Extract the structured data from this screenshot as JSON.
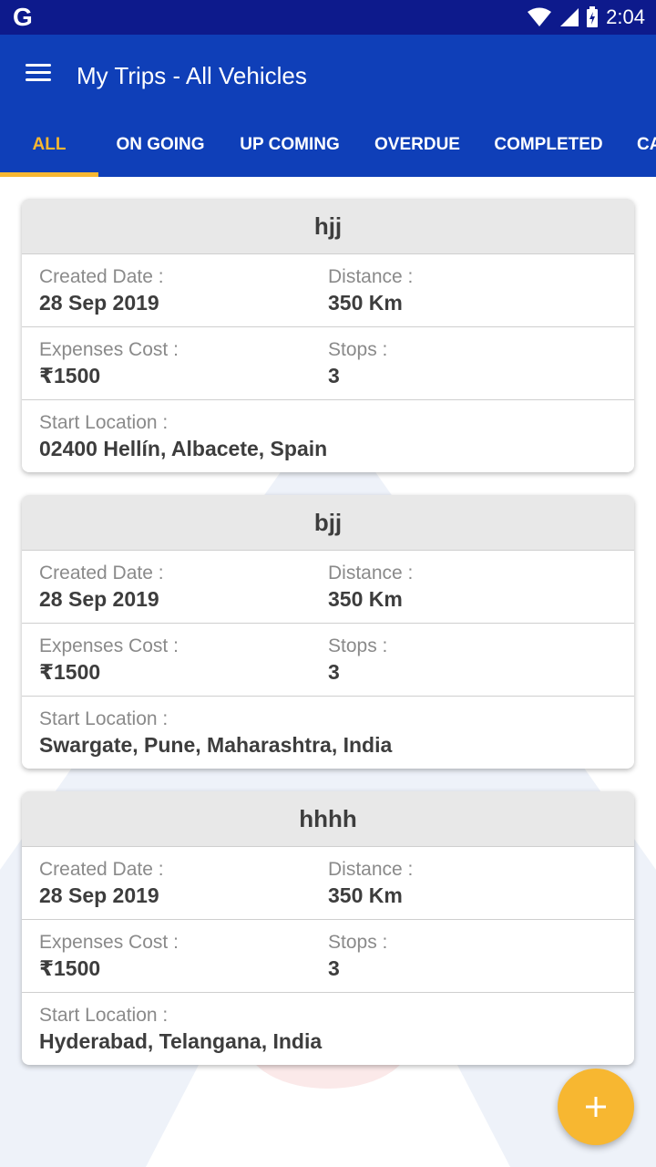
{
  "status_bar": {
    "carrier_icon": "G",
    "time": "2:04"
  },
  "app_bar": {
    "title": "My Trips - All Vehicles"
  },
  "tabs": [
    {
      "label": "ALL",
      "active": true
    },
    {
      "label": "ON GOING",
      "active": false
    },
    {
      "label": "UP COMING",
      "active": false
    },
    {
      "label": "OVERDUE",
      "active": false
    },
    {
      "label": "COMPLETED",
      "active": false
    },
    {
      "label": "CA",
      "active": false
    }
  ],
  "labels": {
    "created_date": "Created Date :",
    "distance": "Distance :",
    "expenses_cost": "Expenses Cost :",
    "stops": "Stops :",
    "start_location": "Start Location :"
  },
  "trips": [
    {
      "name": "hjj",
      "created_date": "28 Sep 2019",
      "distance": "350 Km",
      "expenses_cost": "₹1500",
      "stops": "3",
      "start_location": "02400 Hellín, Albacete, Spain"
    },
    {
      "name": "bjj",
      "created_date": "28 Sep 2019",
      "distance": "350 Km",
      "expenses_cost": "₹1500",
      "stops": "3",
      "start_location": "Swargate, Pune, Maharashtra, India"
    },
    {
      "name": "hhhh",
      "created_date": "28 Sep 2019",
      "distance": "350 Km",
      "expenses_cost": "₹1500",
      "stops": "3",
      "start_location": "Hyderabad, Telangana, India"
    }
  ],
  "colors": {
    "status_bar": "#0d1a8c",
    "app_bar": "#0f3fb8",
    "accent": "#f7b731"
  }
}
